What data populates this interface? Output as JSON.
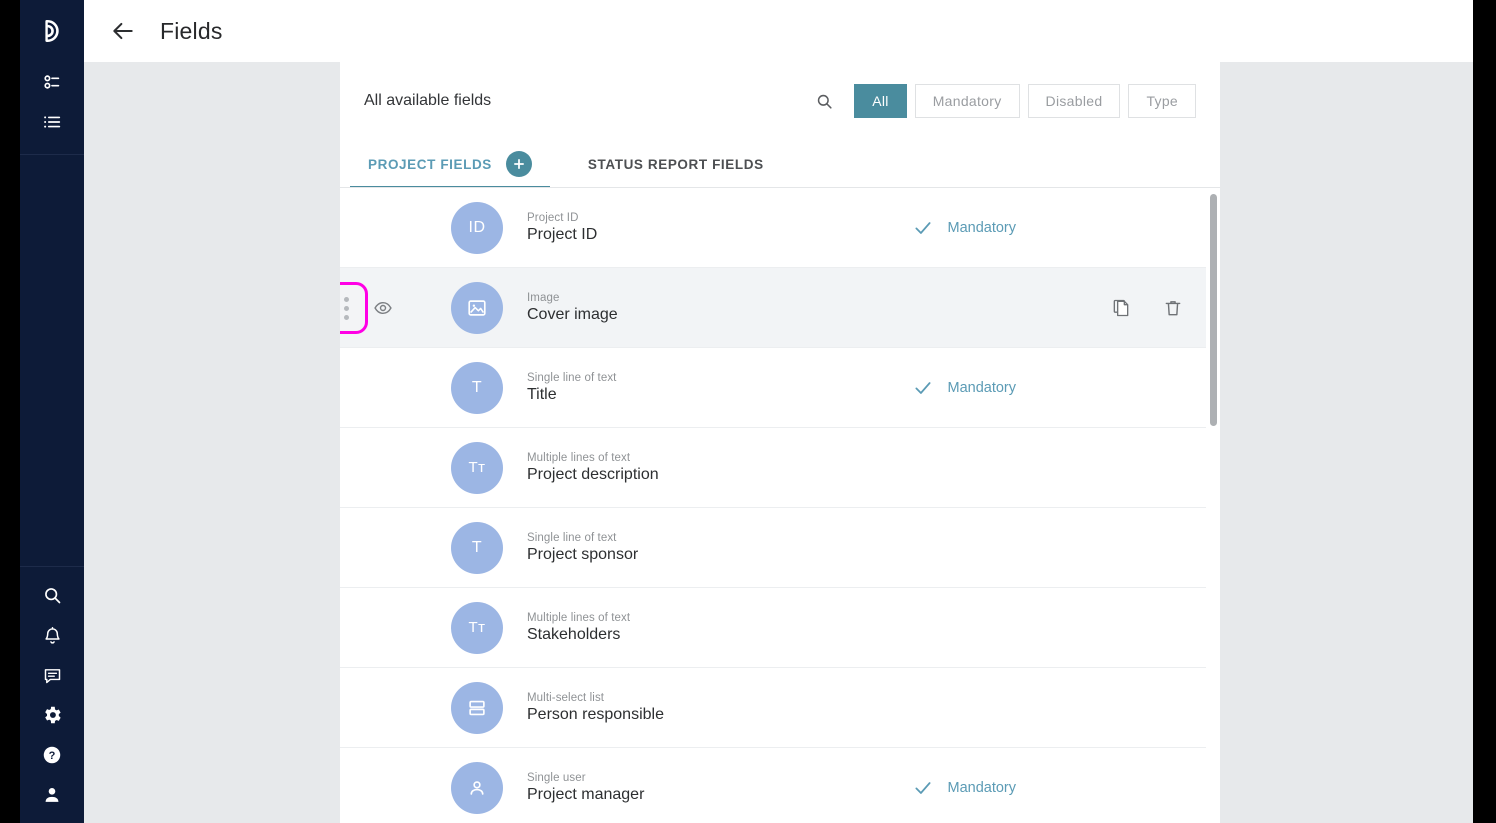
{
  "sidebar": {
    "logo": {
      "name": "app-logo",
      "icon": "crescent-logo-icon"
    },
    "top_items": [
      {
        "icon": "options-list-icon",
        "label": "Options"
      },
      {
        "icon": "list-icon",
        "label": "List"
      }
    ],
    "bottom_items": [
      {
        "icon": "search-icon",
        "label": "Search"
      },
      {
        "icon": "bell-icon",
        "label": "Notifications"
      },
      {
        "icon": "chat-icon",
        "label": "Messages"
      },
      {
        "icon": "gear-icon",
        "label": "Settings"
      },
      {
        "icon": "help-icon",
        "label": "Help"
      },
      {
        "icon": "user-icon",
        "label": "Account"
      }
    ]
  },
  "header": {
    "back_icon": "arrow-left-icon",
    "title": "Fields"
  },
  "card": {
    "title": "All available fields",
    "search_icon": "search-icon",
    "filters": [
      {
        "label": "All",
        "active": true
      },
      {
        "label": "Mandatory",
        "active": false
      },
      {
        "label": "Disabled",
        "active": false
      },
      {
        "label": "Type",
        "active": false
      }
    ],
    "tabs": [
      {
        "label": "PROJECT FIELDS",
        "active": true,
        "has_add": true,
        "add_icon": "plus-icon"
      },
      {
        "label": "STATUS REPORT FIELDS",
        "active": false,
        "has_add": false
      }
    ]
  },
  "fields": [
    {
      "type": "Project ID",
      "name": "Project ID",
      "avatar_text": "ID",
      "avatar_icon": "id-icon",
      "mandatory": true,
      "mandatory_label": "Mandatory",
      "highlighted": false,
      "actions": []
    },
    {
      "type": "Image",
      "name": "Cover image",
      "avatar_text": "",
      "avatar_icon": "image-icon",
      "mandatory": false,
      "mandatory_label": "",
      "highlighted": true,
      "drag_handle_icon": "drag-handle-icon",
      "visibility_icon": "eye-icon",
      "actions": [
        {
          "icon": "copy-icon",
          "label": "Duplicate"
        },
        {
          "icon": "trash-icon",
          "label": "Delete"
        }
      ]
    },
    {
      "type": "Single line of text",
      "name": "Title",
      "avatar_text": "T",
      "avatar_icon": "text-icon",
      "mandatory": true,
      "mandatory_label": "Mandatory",
      "highlighted": false,
      "actions": []
    },
    {
      "type": "Multiple lines of text",
      "name": "Project description",
      "avatar_text": "Tт",
      "avatar_icon": "multiline-text-icon",
      "mandatory": false,
      "mandatory_label": "",
      "highlighted": false,
      "actions": []
    },
    {
      "type": "Single line of text",
      "name": "Project sponsor",
      "avatar_text": "T",
      "avatar_icon": "text-icon",
      "mandatory": false,
      "mandatory_label": "",
      "highlighted": false,
      "actions": []
    },
    {
      "type": "Multiple lines of text",
      "name": "Stakeholders",
      "avatar_text": "Tт",
      "avatar_icon": "multiline-text-icon",
      "mandatory": false,
      "mandatory_label": "",
      "highlighted": false,
      "actions": []
    },
    {
      "type": "Multi-select list",
      "name": "Person responsible",
      "avatar_text": "",
      "avatar_icon": "multiselect-list-icon",
      "mandatory": false,
      "mandatory_label": "",
      "highlighted": false,
      "actions": []
    },
    {
      "type": "Single user",
      "name": "Project manager",
      "avatar_text": "",
      "avatar_icon": "single-user-icon",
      "mandatory": true,
      "mandatory_label": "Mandatory",
      "highlighted": false,
      "actions": []
    }
  ],
  "colors": {
    "accent_teal": "#4a8c9e",
    "link_blue": "#5b9bb5",
    "sidebar_navy": "#0d1b38",
    "avatar_blue": "#9cb6e4",
    "highlight_magenta": "#ff00e5",
    "workarea_gray": "#e7e9eb"
  }
}
